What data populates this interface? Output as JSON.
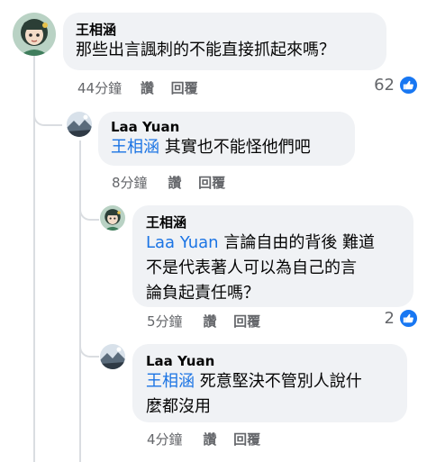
{
  "comments": [
    {
      "author": "王相涵",
      "text": "那些出言諷刺的不能直接抓起來嗎？",
      "time": "44分鐘",
      "like_label": "讚",
      "reply_label": "回覆",
      "reaction_count": "62",
      "avatar_icon": "cartoon-girl-avatar-icon"
    },
    {
      "author": "Laa Yuan",
      "mention": "王相涵",
      "text": "其實也不能怪他們吧",
      "time": "8分鐘",
      "like_label": "讚",
      "reply_label": "回覆",
      "avatar_icon": "landscape-avatar-icon"
    },
    {
      "author": "王相涵",
      "mention": "Laa Yuan",
      "text_lines": [
        "言論自由的背後 難道",
        "不是代表著人可以為自己的言",
        "論負起責任嗎？"
      ],
      "time": "5分鐘",
      "like_label": "讚",
      "reply_label": "回覆",
      "reaction_count": "2",
      "avatar_icon": "cartoon-girl-avatar-icon"
    },
    {
      "author": "Laa Yuan",
      "mention": "王相涵",
      "text_lines": [
        "死意堅決不管別人說什",
        "麼都沒用"
      ],
      "time": "4分鐘",
      "like_label": "讚",
      "reply_label": "回覆",
      "avatar_icon": "landscape-avatar-icon"
    }
  ],
  "colors": {
    "bubble": "#f0f2f5",
    "mention": "#1b74e4",
    "meta": "#65676b",
    "like_badge": "#1877f2"
  }
}
